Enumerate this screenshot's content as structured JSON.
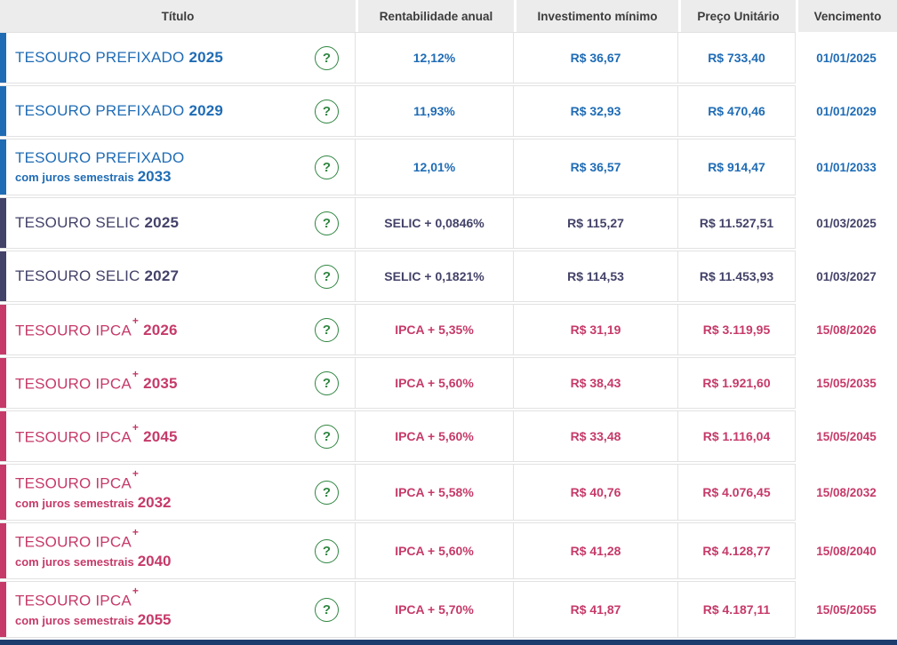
{
  "table": {
    "columns": [
      "Título",
      "Rentabilidade anual",
      "Investimento mínimo",
      "Preço Unitário",
      "Vencimento"
    ],
    "help_label": "?",
    "rows": [
      {
        "title_main": "TESOURO PREFIXADO",
        "title_sup": "",
        "subtitle": "",
        "year": "2025",
        "theme": "prefixado",
        "rate": "12,12%",
        "min_investment": "R$ 36,67",
        "unit_price": "R$ 733,40",
        "maturity": "01/01/2025"
      },
      {
        "title_main": "TESOURO PREFIXADO",
        "title_sup": "",
        "subtitle": "",
        "year": "2029",
        "theme": "prefixado",
        "rate": "11,93%",
        "min_investment": "R$ 32,93",
        "unit_price": "R$ 470,46",
        "maturity": "01/01/2029"
      },
      {
        "title_main": "TESOURO PREFIXADO",
        "title_sup": "",
        "subtitle": "com juros semestrais",
        "year": "2033",
        "theme": "prefixado",
        "rate": "12,01%",
        "min_investment": "R$ 36,57",
        "unit_price": "R$ 914,47",
        "maturity": "01/01/2033"
      },
      {
        "title_main": "TESOURO SELIC",
        "title_sup": "",
        "subtitle": "",
        "year": "2025",
        "theme": "selic",
        "rate": "SELIC + 0,0846%",
        "min_investment": "R$ 115,27",
        "unit_price": "R$ 11.527,51",
        "maturity": "01/03/2025"
      },
      {
        "title_main": "TESOURO SELIC",
        "title_sup": "",
        "subtitle": "",
        "year": "2027",
        "theme": "selic",
        "rate": "SELIC + 0,1821%",
        "min_investment": "R$ 114,53",
        "unit_price": "R$ 11.453,93",
        "maturity": "01/03/2027"
      },
      {
        "title_main": "TESOURO IPCA",
        "title_sup": "+",
        "subtitle": "",
        "year": "2026",
        "theme": "ipca",
        "rate": "IPCA + 5,35%",
        "min_investment": "R$ 31,19",
        "unit_price": "R$ 3.119,95",
        "maturity": "15/08/2026"
      },
      {
        "title_main": "TESOURO IPCA",
        "title_sup": "+",
        "subtitle": "",
        "year": "2035",
        "theme": "ipca",
        "rate": "IPCA + 5,60%",
        "min_investment": "R$ 38,43",
        "unit_price": "R$ 1.921,60",
        "maturity": "15/05/2035"
      },
      {
        "title_main": "TESOURO IPCA",
        "title_sup": "+",
        "subtitle": "",
        "year": "2045",
        "theme": "ipca",
        "rate": "IPCA + 5,60%",
        "min_investment": "R$ 33,48",
        "unit_price": "R$ 1.116,04",
        "maturity": "15/05/2045"
      },
      {
        "title_main": "TESOURO IPCA",
        "title_sup": "+",
        "subtitle": "com juros semestrais",
        "year": "2032",
        "theme": "ipca",
        "rate": "IPCA + 5,58%",
        "min_investment": "R$ 40,76",
        "unit_price": "R$ 4.076,45",
        "maturity": "15/08/2032"
      },
      {
        "title_main": "TESOURO IPCA",
        "title_sup": "+",
        "subtitle": "com juros semestrais",
        "year": "2040",
        "theme": "ipca",
        "rate": "IPCA + 5,60%",
        "min_investment": "R$ 41,28",
        "unit_price": "R$ 4.128,77",
        "maturity": "15/08/2040"
      },
      {
        "title_main": "TESOURO IPCA",
        "title_sup": "+",
        "subtitle": "com juros semestrais",
        "year": "2055",
        "theme": "ipca",
        "rate": "IPCA + 5,70%",
        "min_investment": "R$ 41,87",
        "unit_price": "R$ 4.187,11",
        "maturity": "15/05/2055"
      }
    ]
  },
  "colors": {
    "prefixado": "#1f6cb5",
    "selic": "#434269",
    "ipca": "#c63a69",
    "help": "#2e8540",
    "header-bg": "#ececec",
    "header-text": "#3c3c3c",
    "border": "#e2e2e2",
    "footer": "#1d3c6e"
  }
}
